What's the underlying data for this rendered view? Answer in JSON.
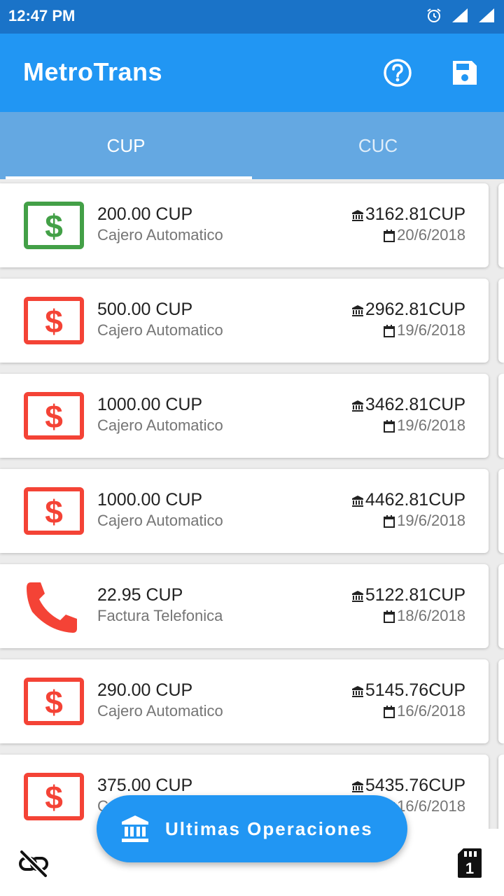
{
  "status_bar": {
    "time": "12:47 PM"
  },
  "app_bar": {
    "title": "MetroTrans",
    "help_icon": "help-circle-icon",
    "save_icon": "floppy-disk-icon"
  },
  "tabs": [
    {
      "label": "CUP",
      "active": true
    },
    {
      "label": "CUC",
      "active": false
    }
  ],
  "transactions": [
    {
      "amount": "200.00 CUP",
      "description": "Cajero Automatico",
      "balance": "3162.81CUP",
      "date": "20/6/2018",
      "icon": "dollar-bill-icon",
      "color": "#43a047"
    },
    {
      "amount": "500.00 CUP",
      "description": "Cajero Automatico",
      "balance": "2962.81CUP",
      "date": "19/6/2018",
      "icon": "dollar-bill-icon",
      "color": "#f44336"
    },
    {
      "amount": "1000.00 CUP",
      "description": "Cajero Automatico",
      "balance": "3462.81CUP",
      "date": "19/6/2018",
      "icon": "dollar-bill-icon",
      "color": "#f44336"
    },
    {
      "amount": "1000.00 CUP",
      "description": "Cajero Automatico",
      "balance": "4462.81CUP",
      "date": "19/6/2018",
      "icon": "dollar-bill-icon",
      "color": "#f44336"
    },
    {
      "amount": "22.95 CUP",
      "description": "Factura Telefonica",
      "balance": "5122.81CUP",
      "date": "18/6/2018",
      "icon": "phone-icon",
      "color": "#f44336"
    },
    {
      "amount": "290.00 CUP",
      "description": "Cajero Automatico",
      "balance": "5145.76CUP",
      "date": "16/6/2018",
      "icon": "dollar-bill-icon",
      "color": "#f44336"
    },
    {
      "amount": "375.00 CUP",
      "description": "Cajero Automatico",
      "balance": "5435.76CUP",
      "date": "16/6/2018",
      "icon": "dollar-bill-icon",
      "color": "#f44336"
    }
  ],
  "fab": {
    "label": "Ultimas Operaciones",
    "icon": "bank-icon"
  },
  "bottom_bar": {
    "left_icon": "link-off-icon",
    "right_icon": "sim-card-1-icon"
  },
  "colors": {
    "primary": "#2196f3",
    "status_bar": "#1a73c8",
    "tab_bar": "#64a8e2",
    "deposit": "#43a047",
    "withdrawal": "#f44336"
  }
}
